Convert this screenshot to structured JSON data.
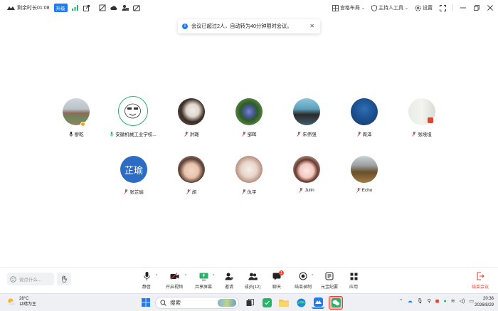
{
  "topbar": {
    "remaining_time": "剩余时长01:08",
    "upgrade_label": "升级",
    "layout_label": "宫格布局",
    "host_tools_label": "主持人工具",
    "settings_label": "设置"
  },
  "toast": {
    "message": "会议已超过2人，自动转为40分钟限时会议。"
  },
  "participants": [
    {
      "name": "廖乾",
      "mic": "on"
    },
    {
      "name": "安徽机械工业学校...",
      "mic": "on"
    },
    {
      "name": "洪璐",
      "mic": "muted"
    },
    {
      "name": "邹晖",
      "mic": "muted"
    },
    {
      "name": "朱伟强",
      "mic": "muted"
    },
    {
      "name": "周泽",
      "mic": "muted"
    },
    {
      "name": "张境坦",
      "mic": "muted"
    },
    {
      "name": "张芷瑜",
      "mic": "muted",
      "avatar_text": "芷瑜"
    },
    {
      "name": "胡",
      "mic": "muted"
    },
    {
      "name": "仇宇",
      "mic": "muted"
    },
    {
      "name": "Julin",
      "mic": "muted"
    },
    {
      "name": "Echo",
      "mic": "muted"
    }
  ],
  "toolbar": {
    "chat_placeholder": "说点什么...",
    "mute_label": "静音",
    "video_label": "开启视频",
    "share_label": "共享屏幕",
    "invite_label": "邀请",
    "members_label": "成员(12)",
    "chat_label": "聊天",
    "chat_badge": "1",
    "record_label": "结束录制",
    "ai_minutes_label": "元宝纪要",
    "apps_label": "应用",
    "end_label": "结束会议"
  },
  "taskbar": {
    "temperature": "28°C",
    "weather_text": "以晴为主",
    "search_label": "搜索",
    "time": "20:36",
    "date": "2026/8/29"
  },
  "colors": {
    "accent": "#1e7bf0",
    "danger": "#e5432f",
    "success": "#26b36a"
  }
}
